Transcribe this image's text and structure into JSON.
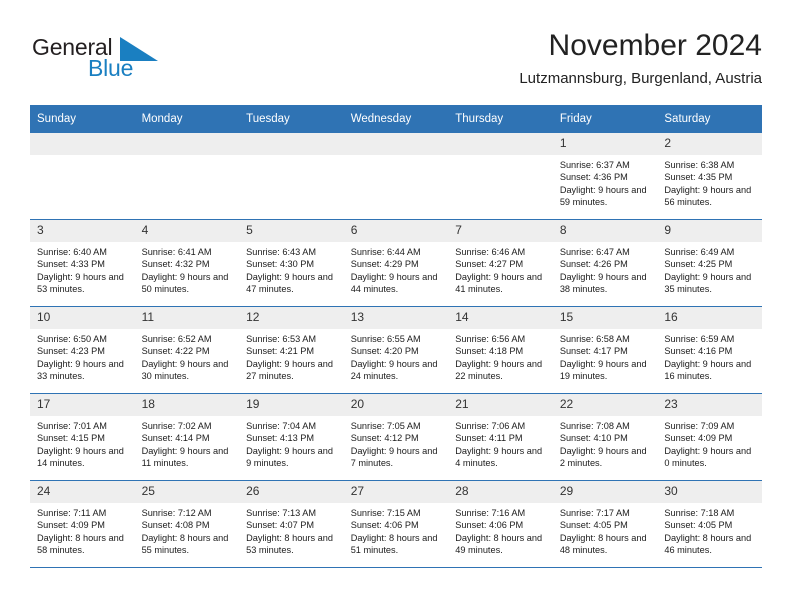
{
  "logo": {
    "word_one": "General",
    "word_two": "Blue",
    "triangle_color": "#1a7fc1",
    "triangle_icon": "triangle-icon"
  },
  "header": {
    "title": "November 2024",
    "location": "Lutzmannsburg, Burgenland, Austria"
  },
  "colors": {
    "header_blue": "#2f73b4",
    "day_band_gray": "#eeeeee",
    "text": "#1c1c1c"
  },
  "calendar": {
    "weekday_headers": [
      "Sunday",
      "Monday",
      "Tuesday",
      "Wednesday",
      "Thursday",
      "Friday",
      "Saturday"
    ],
    "weeks": [
      [
        {
          "day": "",
          "empty": true
        },
        {
          "day": "",
          "empty": true
        },
        {
          "day": "",
          "empty": true
        },
        {
          "day": "",
          "empty": true
        },
        {
          "day": "",
          "empty": true
        },
        {
          "day": "1",
          "sunrise": "Sunrise: 6:37 AM",
          "sunset": "Sunset: 4:36 PM",
          "daylight": "Daylight: 9 hours and 59 minutes."
        },
        {
          "day": "2",
          "sunrise": "Sunrise: 6:38 AM",
          "sunset": "Sunset: 4:35 PM",
          "daylight": "Daylight: 9 hours and 56 minutes."
        }
      ],
      [
        {
          "day": "3",
          "sunrise": "Sunrise: 6:40 AM",
          "sunset": "Sunset: 4:33 PM",
          "daylight": "Daylight: 9 hours and 53 minutes."
        },
        {
          "day": "4",
          "sunrise": "Sunrise: 6:41 AM",
          "sunset": "Sunset: 4:32 PM",
          "daylight": "Daylight: 9 hours and 50 minutes."
        },
        {
          "day": "5",
          "sunrise": "Sunrise: 6:43 AM",
          "sunset": "Sunset: 4:30 PM",
          "daylight": "Daylight: 9 hours and 47 minutes."
        },
        {
          "day": "6",
          "sunrise": "Sunrise: 6:44 AM",
          "sunset": "Sunset: 4:29 PM",
          "daylight": "Daylight: 9 hours and 44 minutes."
        },
        {
          "day": "7",
          "sunrise": "Sunrise: 6:46 AM",
          "sunset": "Sunset: 4:27 PM",
          "daylight": "Daylight: 9 hours and 41 minutes."
        },
        {
          "day": "8",
          "sunrise": "Sunrise: 6:47 AM",
          "sunset": "Sunset: 4:26 PM",
          "daylight": "Daylight: 9 hours and 38 minutes."
        },
        {
          "day": "9",
          "sunrise": "Sunrise: 6:49 AM",
          "sunset": "Sunset: 4:25 PM",
          "daylight": "Daylight: 9 hours and 35 minutes."
        }
      ],
      [
        {
          "day": "10",
          "sunrise": "Sunrise: 6:50 AM",
          "sunset": "Sunset: 4:23 PM",
          "daylight": "Daylight: 9 hours and 33 minutes."
        },
        {
          "day": "11",
          "sunrise": "Sunrise: 6:52 AM",
          "sunset": "Sunset: 4:22 PM",
          "daylight": "Daylight: 9 hours and 30 minutes."
        },
        {
          "day": "12",
          "sunrise": "Sunrise: 6:53 AM",
          "sunset": "Sunset: 4:21 PM",
          "daylight": "Daylight: 9 hours and 27 minutes."
        },
        {
          "day": "13",
          "sunrise": "Sunrise: 6:55 AM",
          "sunset": "Sunset: 4:20 PM",
          "daylight": "Daylight: 9 hours and 24 minutes."
        },
        {
          "day": "14",
          "sunrise": "Sunrise: 6:56 AM",
          "sunset": "Sunset: 4:18 PM",
          "daylight": "Daylight: 9 hours and 22 minutes."
        },
        {
          "day": "15",
          "sunrise": "Sunrise: 6:58 AM",
          "sunset": "Sunset: 4:17 PM",
          "daylight": "Daylight: 9 hours and 19 minutes."
        },
        {
          "day": "16",
          "sunrise": "Sunrise: 6:59 AM",
          "sunset": "Sunset: 4:16 PM",
          "daylight": "Daylight: 9 hours and 16 minutes."
        }
      ],
      [
        {
          "day": "17",
          "sunrise": "Sunrise: 7:01 AM",
          "sunset": "Sunset: 4:15 PM",
          "daylight": "Daylight: 9 hours and 14 minutes."
        },
        {
          "day": "18",
          "sunrise": "Sunrise: 7:02 AM",
          "sunset": "Sunset: 4:14 PM",
          "daylight": "Daylight: 9 hours and 11 minutes."
        },
        {
          "day": "19",
          "sunrise": "Sunrise: 7:04 AM",
          "sunset": "Sunset: 4:13 PM",
          "daylight": "Daylight: 9 hours and 9 minutes."
        },
        {
          "day": "20",
          "sunrise": "Sunrise: 7:05 AM",
          "sunset": "Sunset: 4:12 PM",
          "daylight": "Daylight: 9 hours and 7 minutes."
        },
        {
          "day": "21",
          "sunrise": "Sunrise: 7:06 AM",
          "sunset": "Sunset: 4:11 PM",
          "daylight": "Daylight: 9 hours and 4 minutes."
        },
        {
          "day": "22",
          "sunrise": "Sunrise: 7:08 AM",
          "sunset": "Sunset: 4:10 PM",
          "daylight": "Daylight: 9 hours and 2 minutes."
        },
        {
          "day": "23",
          "sunrise": "Sunrise: 7:09 AM",
          "sunset": "Sunset: 4:09 PM",
          "daylight": "Daylight: 9 hours and 0 minutes."
        }
      ],
      [
        {
          "day": "24",
          "sunrise": "Sunrise: 7:11 AM",
          "sunset": "Sunset: 4:09 PM",
          "daylight": "Daylight: 8 hours and 58 minutes."
        },
        {
          "day": "25",
          "sunrise": "Sunrise: 7:12 AM",
          "sunset": "Sunset: 4:08 PM",
          "daylight": "Daylight: 8 hours and 55 minutes."
        },
        {
          "day": "26",
          "sunrise": "Sunrise: 7:13 AM",
          "sunset": "Sunset: 4:07 PM",
          "daylight": "Daylight: 8 hours and 53 minutes."
        },
        {
          "day": "27",
          "sunrise": "Sunrise: 7:15 AM",
          "sunset": "Sunset: 4:06 PM",
          "daylight": "Daylight: 8 hours and 51 minutes."
        },
        {
          "day": "28",
          "sunrise": "Sunrise: 7:16 AM",
          "sunset": "Sunset: 4:06 PM",
          "daylight": "Daylight: 8 hours and 49 minutes."
        },
        {
          "day": "29",
          "sunrise": "Sunrise: 7:17 AM",
          "sunset": "Sunset: 4:05 PM",
          "daylight": "Daylight: 8 hours and 48 minutes."
        },
        {
          "day": "30",
          "sunrise": "Sunrise: 7:18 AM",
          "sunset": "Sunset: 4:05 PM",
          "daylight": "Daylight: 8 hours and 46 minutes."
        }
      ]
    ]
  }
}
